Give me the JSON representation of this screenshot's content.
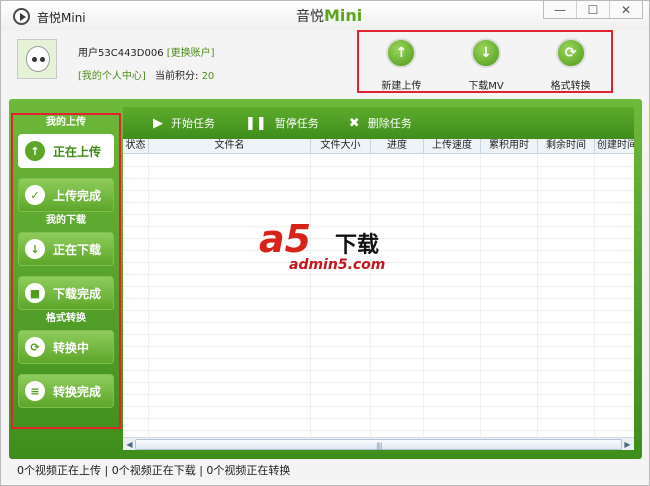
{
  "titlebar": {
    "app_name": "音悦Mini",
    "center_title_a": "音悦",
    "center_title_b": "Mini",
    "minimize_glyph": "—",
    "maximize_glyph": "☐",
    "close_glyph": "✕"
  },
  "user": {
    "id_label": "用户53C443D006",
    "switch_account": "[更换账户]",
    "personal_center": "[我的个人中心]",
    "points_label": "当前积分:",
    "points_value": "20"
  },
  "top_actions": [
    {
      "label": "新建上传",
      "icon": "upload-icon",
      "glyph": "↑"
    },
    {
      "label": "下载MV",
      "icon": "download-icon",
      "glyph": "↓"
    },
    {
      "label": "格式转换",
      "icon": "convert-icon",
      "glyph": "⟳"
    }
  ],
  "sidebar": {
    "sections": [
      "我的上传",
      "我的下载",
      "格式转换"
    ],
    "items": [
      {
        "label": "正在上传",
        "icon": "upload-arrow-icon",
        "glyph": "↑",
        "active": true
      },
      {
        "label": "上传完成",
        "icon": "check-icon",
        "glyph": "✓",
        "active": false
      },
      {
        "label": "正在下载",
        "icon": "download-arrow-icon",
        "glyph": "↓",
        "active": false
      },
      {
        "label": "下载完成",
        "icon": "box-icon",
        "glyph": "■",
        "active": false
      },
      {
        "label": "转换中",
        "icon": "convert-icon",
        "glyph": "⟳",
        "active": false
      },
      {
        "label": "转换完成",
        "icon": "list-icon",
        "glyph": "≡",
        "active": false
      }
    ]
  },
  "toolbar": {
    "start": "开始任务",
    "pause": "暂停任务",
    "delete": "删除任务"
  },
  "table": {
    "columns": [
      "状态",
      "文件名",
      "文件大小",
      "进度",
      "上传速度",
      "累积用时",
      "剩余时间",
      "创建时间"
    ]
  },
  "watermark": {
    "logo": "a5",
    "logo_text": "下载",
    "site": "admin5.com"
  },
  "status": "0个视频正在上传 | 0个视频正在下载 | 0个视频正在转换",
  "colors": {
    "accent_green": "#4c9a19",
    "highlight_red": "#e0232f"
  }
}
